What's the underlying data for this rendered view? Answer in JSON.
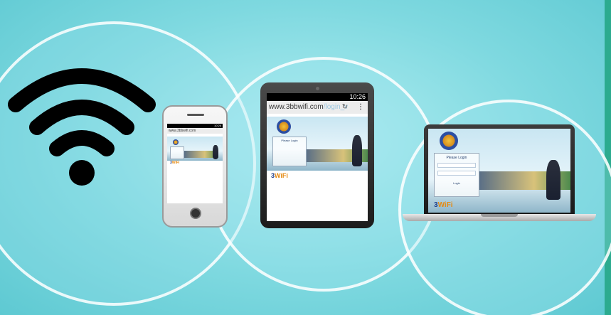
{
  "colors": {
    "background": "#7fd9e0",
    "ring": "#ffffff",
    "brand_blue": "#1f3e8a",
    "brand_orange": "#e58a12",
    "side_bar": "#2cab8f"
  },
  "tablet": {
    "status_time": "10:26",
    "url_main": "www.3bbwifi.com",
    "url_tail": "/login_v",
    "login_title": "Please Login",
    "logo_text": "3",
    "logo_suffix": "WiFi"
  },
  "phone": {
    "status_time": "10:26",
    "url_main": "www.3bbwifi.com",
    "logo_text": "3",
    "logo_suffix": "WiFi"
  },
  "laptop": {
    "login_title": "Please Login",
    "login_button": "Login",
    "logo_text": "3",
    "logo_suffix": "WiFi"
  },
  "icons": [
    "wifi-signal-icon",
    "refresh-icon",
    "menu-dots-icon",
    "home-button-icon"
  ]
}
